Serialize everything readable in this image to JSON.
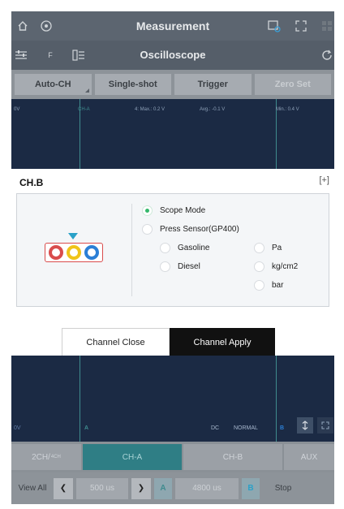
{
  "header": {
    "title": "Measurement"
  },
  "subheader": {
    "title": "Oscilloscope",
    "left_label": "F"
  },
  "toolbar": {
    "auto_ch": "Auto-CH",
    "single_shot": "Single-shot",
    "trigger": "Trigger",
    "zero_set": "Zero Set"
  },
  "scope_top": {
    "left_unit": "0V",
    "channel": "CH-A",
    "max": "4: Max.: 0.2 V",
    "avg": "Avg.: -0.1 V",
    "min": "Min.: 0.4 V"
  },
  "modal": {
    "title": "CH.B",
    "expand_icon": "expand-icon",
    "options": {
      "scope_mode": "Scope Mode",
      "press_sensor": "Press Sensor(GP400)",
      "gasoline": "Gasoline",
      "diesel": "Diesel",
      "pa": "Pa",
      "kgcm2": "kg/cm2",
      "bar": "bar"
    },
    "selected": "Scope Mode",
    "close_label": "Channel Close",
    "apply_label": "Channel Apply"
  },
  "scope_bottom": {
    "left_unit": "0V",
    "marker_a": "A",
    "coupling": "DC",
    "mode": "NORMAL",
    "marker_b": "B"
  },
  "channel_tabs": {
    "mode": "2CH/",
    "mode_small": "4CH",
    "ch_a": "CH-A",
    "ch_b": "CH-B",
    "aux": "AUX"
  },
  "navbar": {
    "view_all": "View All",
    "time_left": "500 us",
    "a_label": "A",
    "time_right": "4800 us",
    "b_label": "B",
    "stop": "Stop"
  },
  "colors": {
    "header": "#5c6570",
    "scope_bg": "#1b2a44",
    "trace": "#3f8b8e",
    "radio_selected": "#34b86b",
    "apply_button": "#111111",
    "probe_red": "#d94c4c",
    "probe_yellow": "#f0c419",
    "probe_blue": "#2b7fd6",
    "probe_arrow": "#2aa1c8"
  }
}
